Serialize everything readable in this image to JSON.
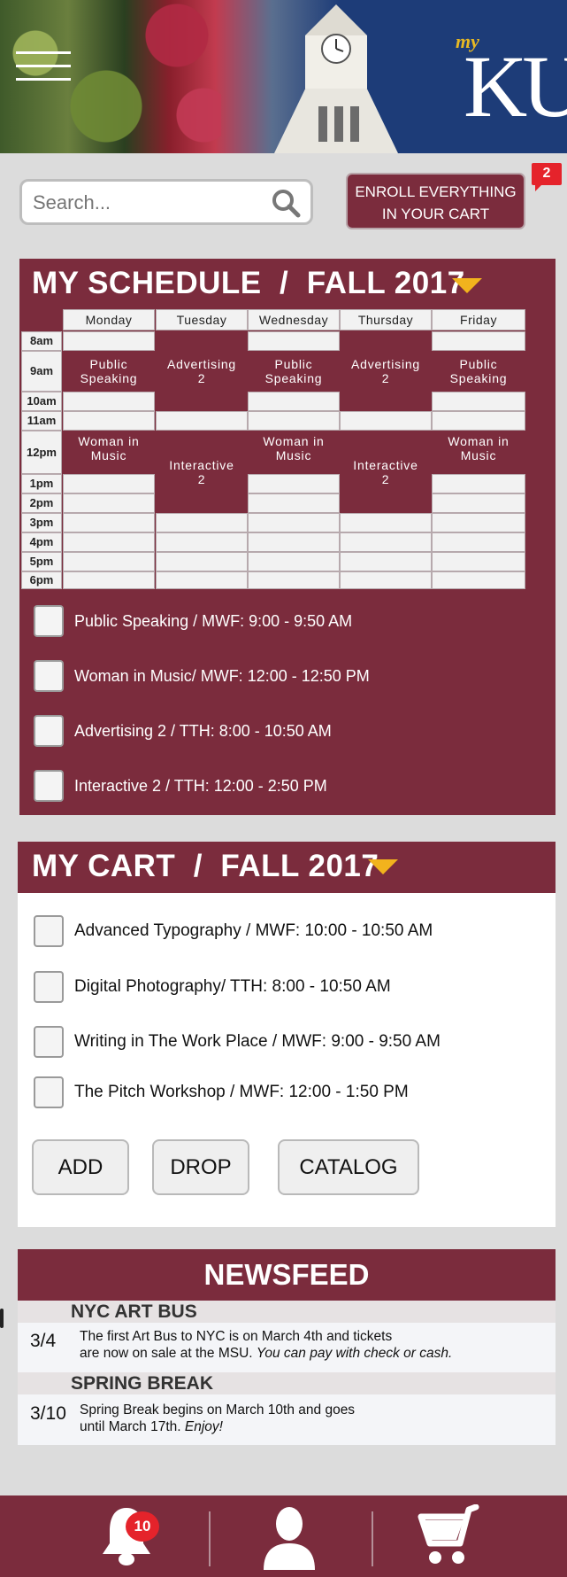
{
  "header": {
    "logo_my": "my",
    "logo_ku": "KU"
  },
  "search": {
    "placeholder": "Search..."
  },
  "enroll": {
    "line1": "ENROLL EVERYTHING",
    "line2": "IN YOUR CART",
    "badge": "2"
  },
  "schedule": {
    "title": "MY SCHEDULE  /  FALL 2017",
    "days": [
      "Monday",
      "Tuesday",
      "Wednesday",
      "Thursday",
      "Friday"
    ],
    "times": [
      "8am",
      "9am",
      "10am",
      "11am",
      "12pm",
      "1pm",
      "2pm",
      "3pm",
      "4pm",
      "5pm",
      "6pm"
    ],
    "blocks": {
      "mon_ps": [
        "Public",
        "Speaking"
      ],
      "tue_adv": [
        "Advertising",
        "2"
      ],
      "wed_ps": [
        "Public",
        "Speaking"
      ],
      "thu_adv": [
        "Advertising",
        "2"
      ],
      "fri_ps": [
        "Public",
        "Speaking"
      ],
      "mon_wim": [
        "Woman in",
        "Music"
      ],
      "tue_int": [
        "Interactive",
        "2"
      ],
      "wed_wim": [
        "Woman in",
        "Music"
      ],
      "thu_int": [
        "Interactive",
        "2"
      ],
      "fri_wim": [
        "Woman in",
        "Music"
      ]
    },
    "courses": [
      "Public Speaking / MWF: 9:00 - 9:50 AM",
      "Woman in Music/ MWF: 12:00 - 12:50 PM",
      "Advertising 2 / TTH: 8:00 - 10:50 AM",
      "Interactive 2 / TTH: 12:00 - 2:50 PM"
    ]
  },
  "cart": {
    "title": "MY CART  /  FALL 2017",
    "items": [
      "Advanced Typography / MWF: 10:00 - 10:50 AM",
      "Digital Photography/ TTH: 8:00 - 10:50 AM",
      "Writing in The Work Place / MWF: 9:00 - 9:50 AM",
      "The Pitch Workshop / MWF: 12:00 - 1:50 PM"
    ],
    "buttons": {
      "add": "ADD",
      "drop": "DROP",
      "catalog": "CATALOG"
    }
  },
  "news": {
    "title": "NEWSFEED",
    "items": [
      {
        "title": "NYC ART BUS",
        "date": "3/4",
        "line1": "The first Art Bus to NYC is on March 4th and tickets",
        "line2a": "are now on sale at the MSU. ",
        "line2b": "You can pay with check or cash."
      },
      {
        "title": "SPRING BREAK",
        "date": "3/10",
        "line1": "Spring Break begins on March 10th and goes",
        "line2a": "until March 17th. ",
        "line2b": "Enjoy!"
      }
    ]
  },
  "nav": {
    "notifications": "10"
  },
  "colors": {
    "maroon": "#7b2c3d",
    "gold": "#f2b31d",
    "badge_red": "#e5232b"
  }
}
